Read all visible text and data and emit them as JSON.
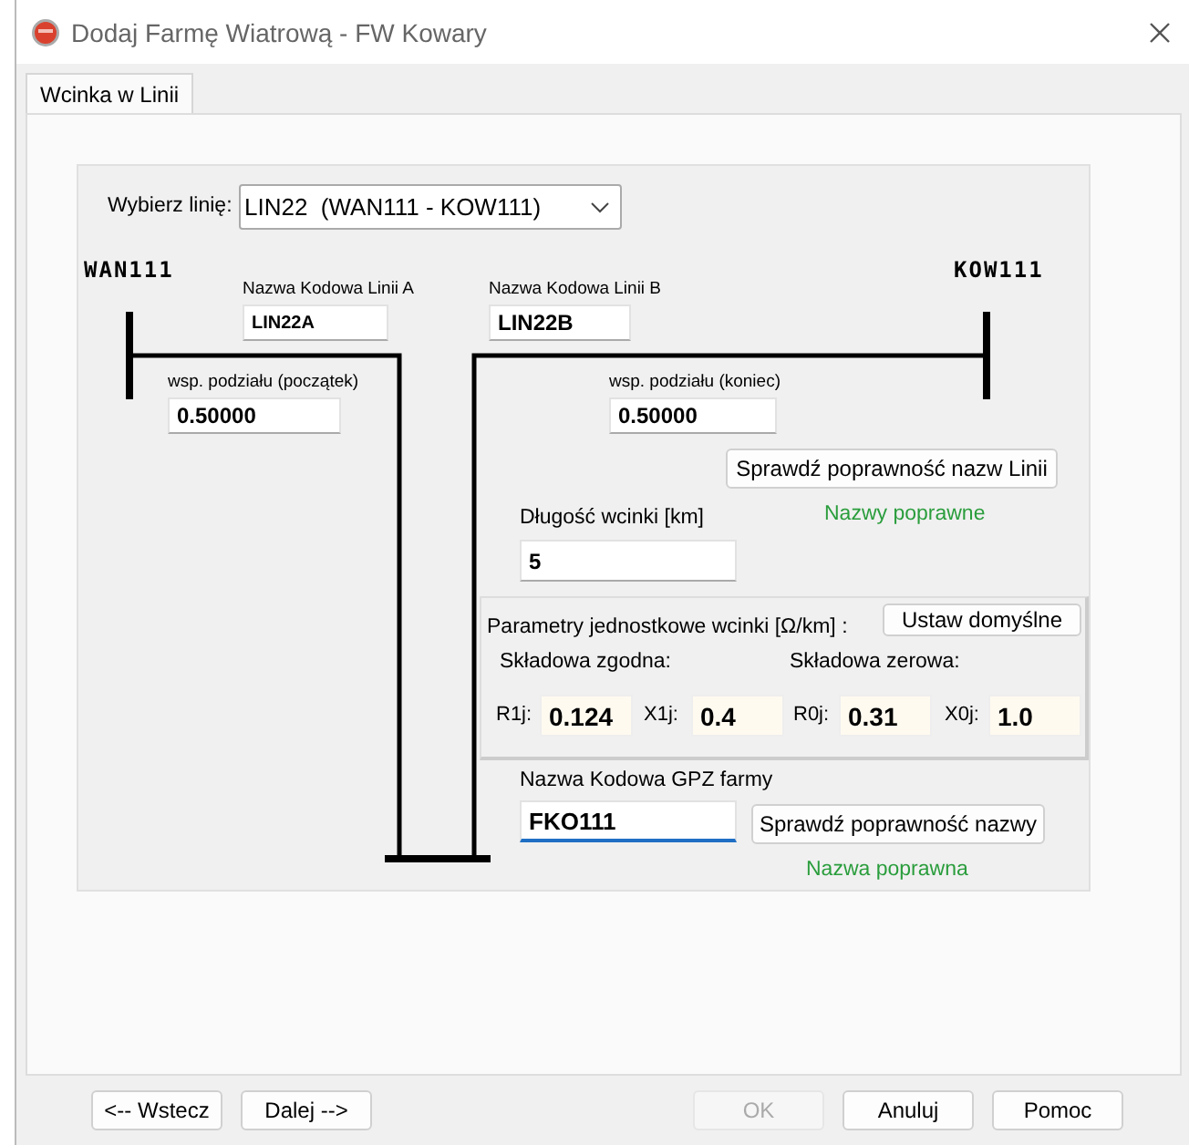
{
  "window": {
    "title": "Dodaj Farmę Wiatrową - FW Kowary"
  },
  "tabs": [
    {
      "label": "Wcinka w Linii",
      "selected": true
    }
  ],
  "line_select": {
    "label": "Wybierz linię:",
    "value": "LIN22  (WAN111 - KOW111)"
  },
  "bus_a": "WAN111",
  "bus_b": "KOW111",
  "line_a": {
    "label": "Nazwa Kodowa Linii A",
    "value": "LIN22A"
  },
  "line_b": {
    "label": "Nazwa Kodowa Linii B",
    "value": "LIN22B"
  },
  "split_start": {
    "label": "wsp. podziału (początek)",
    "value": "0.50000"
  },
  "split_end": {
    "label": "wsp. podziału (koniec)",
    "value": "0.50000"
  },
  "check_lines_button": "Sprawdź poprawność nazw Linii",
  "lines_status": "Nazwy poprawne",
  "length": {
    "label": "Długość wcinki [km]",
    "value": "5"
  },
  "parameters": {
    "title": "Parametry jednostkowe wcinki [Ω/km] :",
    "default_button": "Ustaw domyślne",
    "positive_label": "Składowa zgodna:",
    "zero_label": "Składowa zerowa:",
    "values": [
      {
        "label": "R1j:",
        "value": "0.124"
      },
      {
        "label": "X1j:",
        "value": "0.4"
      },
      {
        "label": "R0j:",
        "value": "0.31"
      },
      {
        "label": "X0j:",
        "value": "1.0"
      }
    ]
  },
  "gpz": {
    "label": "Nazwa Kodowa GPZ farmy",
    "value": "FKO111"
  },
  "check_gpz_button": "Sprawdź poprawność nazwy",
  "gpz_status": "Nazwa poprawna",
  "buttons": [
    {
      "label": "<-- Wstecz",
      "disabled": false
    },
    {
      "label": "Dalej -->",
      "disabled": false
    },
    {
      "label": "OK",
      "disabled": true
    },
    {
      "label": "Anuluj",
      "disabled": false
    },
    {
      "label": "Pomoc",
      "disabled": false
    }
  ]
}
